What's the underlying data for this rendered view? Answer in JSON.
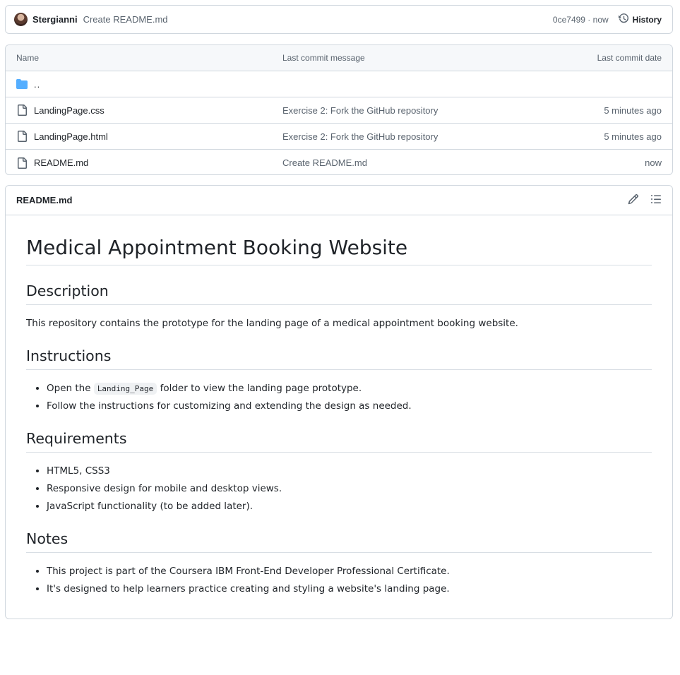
{
  "commit": {
    "author": "Stergianni",
    "message": "Create README.md",
    "sha": "0ce7499",
    "time": "now",
    "history_label": "History"
  },
  "file_table": {
    "headers": {
      "name": "Name",
      "message": "Last commit message",
      "date": "Last commit date"
    },
    "parent": "..",
    "rows": [
      {
        "name": "LandingPage.css",
        "message": "Exercise 2: Fork the GitHub repository",
        "date": "5 minutes ago"
      },
      {
        "name": "LandingPage.html",
        "message": "Exercise 2: Fork the GitHub repository",
        "date": "5 minutes ago"
      },
      {
        "name": "README.md",
        "message": "Create README.md",
        "date": "now"
      }
    ]
  },
  "readme": {
    "filename": "README.md",
    "title": "Medical Appointment Booking Website",
    "sections": {
      "description": {
        "heading": "Description",
        "text": "This repository contains the prototype for the landing page of a medical appointment booking website."
      },
      "instructions": {
        "heading": "Instructions",
        "item1_pre": "Open the",
        "item1_code": "Landing_Page",
        "item1_post": "folder to view the landing page prototype.",
        "item2": "Follow the instructions for customizing and extending the design as needed."
      },
      "requirements": {
        "heading": "Requirements",
        "items": [
          "HTML5, CSS3",
          "Responsive design for mobile and desktop views.",
          "JavaScript functionality (to be added later)."
        ]
      },
      "notes": {
        "heading": "Notes",
        "items": [
          "This project is part of the Coursera IBM Front-End Developer Professional Certificate.",
          "It's designed to help learners practice creating and styling a website's landing page."
        ]
      }
    }
  },
  "colors": {
    "folder": "#54aeff",
    "muted": "#59636e",
    "border": "#d0d7de"
  },
  "icons": {
    "history": "history-icon",
    "folder": "folder-icon",
    "file": "file-icon",
    "edit": "pencil-icon",
    "toc": "list-icon"
  }
}
